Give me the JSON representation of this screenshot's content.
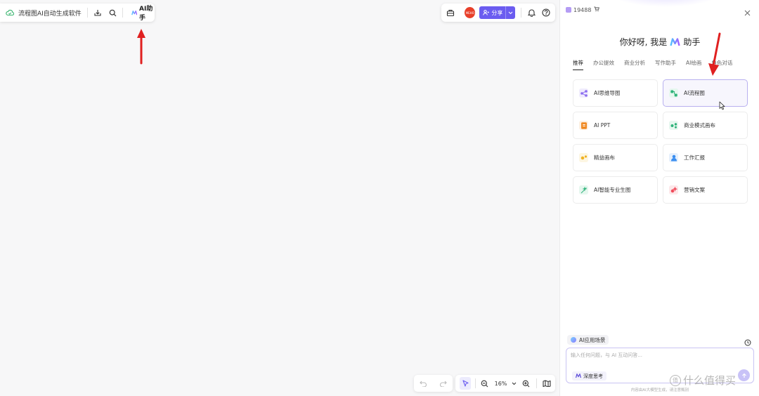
{
  "toolbar_left": {
    "doc_title": "流程图AI自动生成软件",
    "ai_button_label": "AI助手"
  },
  "toolbar_right": {
    "share_label": "分享",
    "avatar_text": "MEHO"
  },
  "canvas_toolbar": {
    "zoom_level": "16%"
  },
  "ai_panel": {
    "credits": "19488",
    "greeting_prefix": "你好呀, 我是",
    "greeting_suffix": "助手",
    "tabs": [
      {
        "label": "推荐",
        "active": true
      },
      {
        "label": "办公提效"
      },
      {
        "label": "商业分析"
      },
      {
        "label": "写作助手"
      },
      {
        "label": "AI绘画"
      },
      {
        "label": "角色对话"
      }
    ],
    "cards": [
      {
        "label": "AI思维导图",
        "icon": "mindmap-icon",
        "color": "#8b6cf0",
        "bg": "#f0ecfd"
      },
      {
        "label": "AI流程图",
        "icon": "flowchart-icon",
        "color": "#2fb37a",
        "bg": "#e6f7ef",
        "hover": true
      },
      {
        "label": "AI PPT",
        "icon": "ppt-icon",
        "color": "#f08a24",
        "bg": "#fdf0e2"
      },
      {
        "label": "商业模式画布",
        "icon": "business-canvas-icon",
        "color": "#2fb37a",
        "bg": "#e6f7ef"
      },
      {
        "label": "精益画布",
        "icon": "lean-canvas-icon",
        "color": "#f0b324",
        "bg": "#fdf6e2"
      },
      {
        "label": "工作汇报",
        "icon": "work-report-icon",
        "color": "#3a8ef0",
        "bg": "#e6f0fd"
      },
      {
        "label": "AI智能专业生图",
        "icon": "image-gen-icon",
        "color": "#2fb37a",
        "bg": "#e6f7ef"
      },
      {
        "label": "营销文案",
        "icon": "marketing-icon",
        "color": "#f04a5a",
        "bg": "#fde8ea"
      }
    ],
    "scene_chip": "AI应用场景",
    "input_placeholder": "输入任何问题，与 AI 互动问答...",
    "deep_think_label": "深度思考",
    "disclaimer": "内容由AI大模型生成，请注意甄别"
  },
  "watermark": {
    "badge": "值",
    "text": "什么值得买"
  },
  "colors": {
    "accent": "#6b5cf0",
    "arrow": "#e02020"
  }
}
